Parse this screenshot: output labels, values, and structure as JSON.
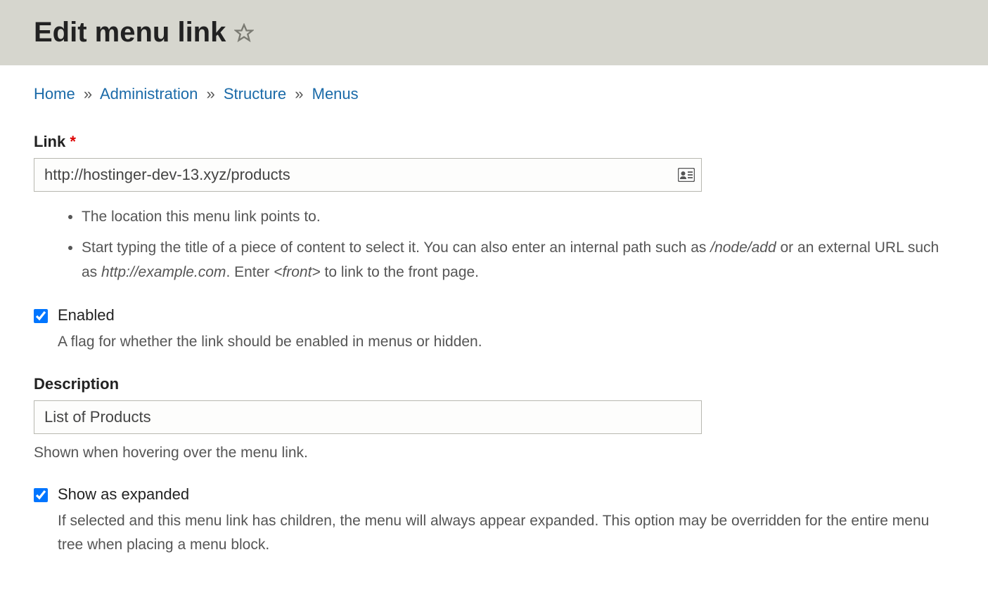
{
  "header": {
    "title": "Edit menu link"
  },
  "breadcrumb": {
    "items": [
      "Home",
      "Administration",
      "Structure",
      "Menus"
    ]
  },
  "form": {
    "link": {
      "label": "Link",
      "value": "http://hostinger-dev-13.xyz/products",
      "help1": "The location this menu link points to.",
      "help2a": "Start typing the title of a piece of content to select it. You can also enter an internal path such as ",
      "help2_path1": "/node/add",
      "help2b": " or an external URL such as ",
      "help2_path2": "http://example.com",
      "help2c": ". Enter ",
      "help2_path3": "<front>",
      "help2d": " to link to the front page."
    },
    "enabled": {
      "label": "Enabled",
      "help": "A flag for whether the link should be enabled in menus or hidden."
    },
    "description": {
      "label": "Description",
      "value": "List of Products",
      "help": "Shown when hovering over the menu link."
    },
    "expanded": {
      "label": "Show as expanded",
      "help": "If selected and this menu link has children, the menu will always appear expanded. This option may be overridden for the entire menu tree when placing a menu block."
    }
  }
}
